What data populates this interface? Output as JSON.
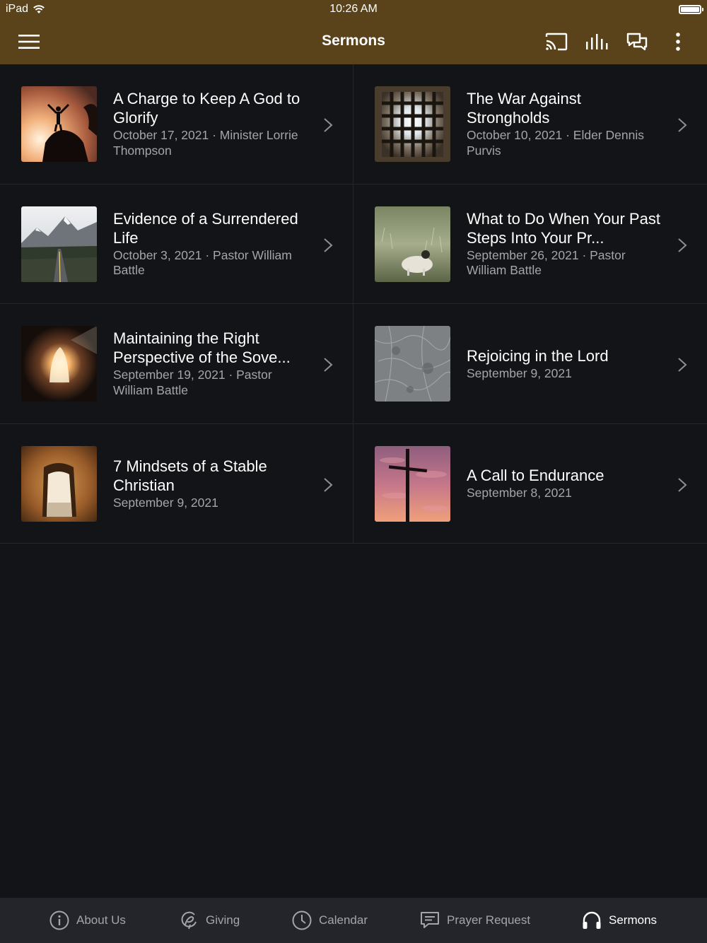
{
  "status": {
    "device": "iPad",
    "time": "10:26 AM"
  },
  "header": {
    "title": "Sermons"
  },
  "sermons": [
    {
      "title": "A Charge to Keep A God to Glorify",
      "date": "October 17, 2021",
      "speaker": "Minister Lorrie Thompson",
      "subtitle": "October 17, 2021 · Minister Lorrie Thompson"
    },
    {
      "title": "The War Against Strongholds",
      "date": "October 10, 2021",
      "speaker": "Elder Dennis Purvis",
      "subtitle": "October 10, 2021 · Elder Dennis Purvis"
    },
    {
      "title": "Evidence of a Surrendered Life",
      "date": "October 3, 2021",
      "speaker": "Pastor William Battle",
      "subtitle": "October 3, 2021 · Pastor William Battle"
    },
    {
      "title": "What to Do When Your Past Steps Into Your Pr...",
      "date": "September 26, 2021",
      "speaker": "Pastor William Battle",
      "subtitle": "September 26, 2021 · Pastor William Battle"
    },
    {
      "title": "Maintaining the Right Perspective of the Sove...",
      "date": "September 19, 2021",
      "speaker": "Pastor William Battle",
      "subtitle": "September 19, 2021 · Pastor William Battle"
    },
    {
      "title": "Rejoicing in the Lord",
      "date": "September 9, 2021",
      "speaker": "",
      "subtitle": "September 9, 2021"
    },
    {
      "title": "7 Mindsets of a Stable Christian",
      "date": "September 9, 2021",
      "speaker": "",
      "subtitle": "September 9, 2021"
    },
    {
      "title": "A Call to Endurance",
      "date": "September 8, 2021",
      "speaker": "",
      "subtitle": "September 8, 2021"
    }
  ],
  "tabs": [
    {
      "label": "About Us",
      "icon": "info-icon"
    },
    {
      "label": "Giving",
      "icon": "giving-icon"
    },
    {
      "label": "Calendar",
      "icon": "clock-icon"
    },
    {
      "label": "Prayer Request",
      "icon": "message-icon"
    },
    {
      "label": "Sermons",
      "icon": "headphones-icon",
      "active": true
    }
  ],
  "colors": {
    "header": "#5a421a",
    "background": "#131417",
    "tabbar": "#24252a",
    "subtext": "#a3a5aa"
  }
}
